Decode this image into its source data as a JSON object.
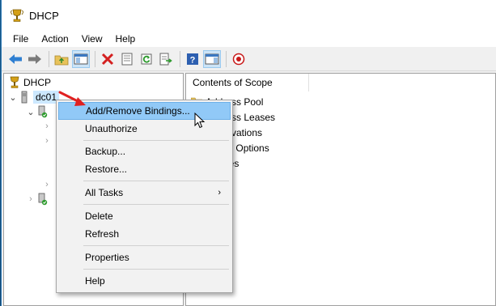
{
  "window": {
    "title": "DHCP"
  },
  "menubar": {
    "items": [
      "File",
      "Action",
      "View",
      "Help"
    ]
  },
  "toolbar": {
    "buttons": [
      "back-icon",
      "forward-icon",
      "up-folder-icon",
      "show-hide-tree-icon",
      "delete-icon",
      "properties-icon",
      "refresh-icon",
      "export-list-icon",
      "help-icon",
      "show-action-pane-icon",
      "stop-icon"
    ]
  },
  "tree": {
    "root_label": "DHCP",
    "server_label": "dc01"
  },
  "content": {
    "column_header": "Contents of Scope",
    "items": [
      "Address Pool",
      "Address Leases",
      "Reservations",
      "Scope Options",
      "Policies"
    ]
  },
  "context_menu": {
    "items": [
      {
        "label": "Add/Remove Bindings...",
        "highlighted": true
      },
      {
        "label": "Unauthorize"
      },
      {
        "label": "Backup..."
      },
      {
        "label": "Restore..."
      },
      {
        "label": "All Tasks",
        "submenu": true
      },
      {
        "label": "Delete"
      },
      {
        "label": "Refresh"
      },
      {
        "label": "Properties"
      },
      {
        "label": "Help"
      }
    ]
  },
  "colors": {
    "highlight": "#91c9f7",
    "annotation_arrow": "#e02020"
  }
}
